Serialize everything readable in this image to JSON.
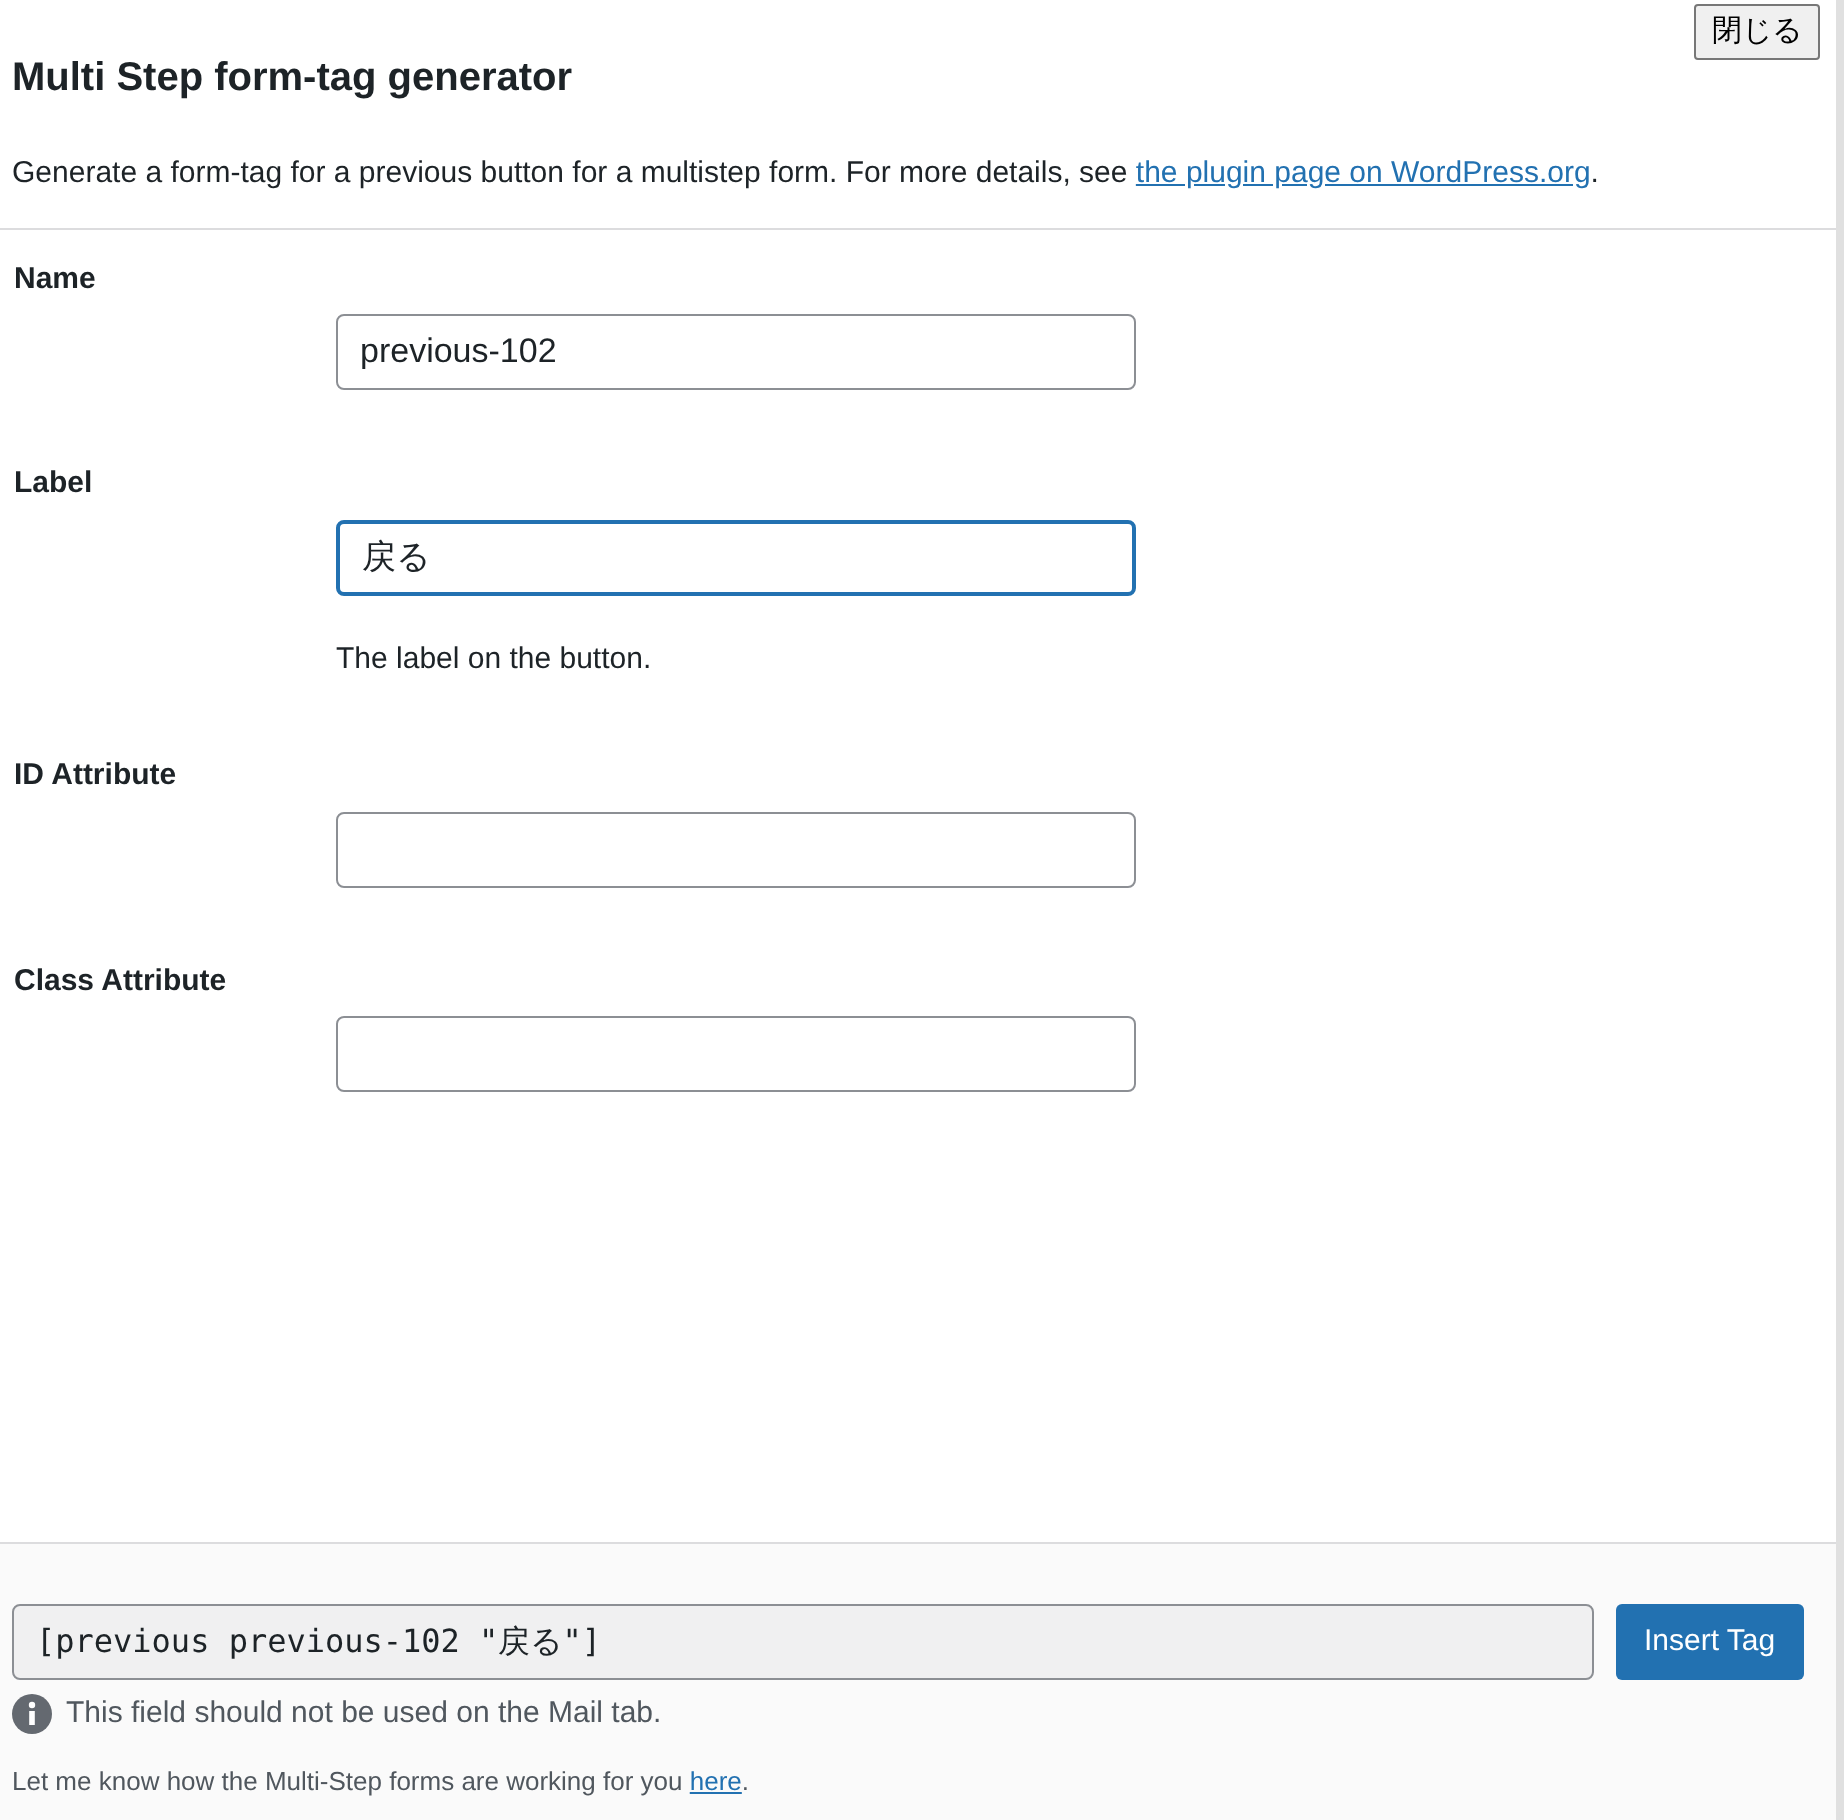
{
  "close_button": "閉じる",
  "title": "Multi Step form-tag generator",
  "description": {
    "text": "Generate a form-tag for a previous button for a multistep form. For more details, see ",
    "link": "the plugin page on WordPress.org",
    "after": "."
  },
  "fields": [
    {
      "label": "Name",
      "value": "previous-102",
      "focused": false
    },
    {
      "label": "Label",
      "value": "戻る",
      "focused": true,
      "hint": "The label on the button."
    },
    {
      "label": "ID Attribute",
      "focused": false
    },
    {
      "label": "Class Attribute",
      "focused": false
    }
  ],
  "tag_field": {
    "value": "[previous previous-102 \"戻る\"]"
  },
  "insert_button": "Insert Tag",
  "notice": "This field should not be used on the Mail tab.",
  "feedback": {
    "text": "Let me know how the Multi-Step forms are working for you ",
    "link": "here",
    "after": "."
  }
}
